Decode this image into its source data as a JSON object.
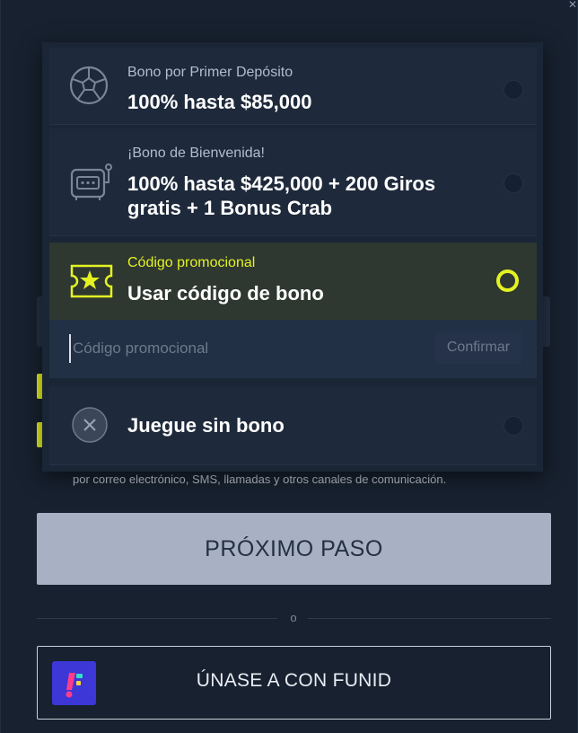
{
  "offers": [
    {
      "icon": "soccer-ball-icon",
      "subtitle": "Bono por Primer Depósito",
      "title": "100% hasta $85,000",
      "selected": false
    },
    {
      "icon": "slot-machine-icon",
      "subtitle": "¡Bono de Bienvenida!",
      "title": "100% hasta $425,000 + 200 Giros gratis + 1 Bonus Crab",
      "selected": false
    },
    {
      "icon": "ticket-star-icon",
      "subtitle": "Código promocional",
      "title": "Usar código de bono",
      "selected": true
    },
    {
      "icon": "close-circle-icon",
      "title": "Juegue sin bono",
      "selected": false
    }
  ],
  "promo": {
    "placeholder": "Código promocional",
    "confirm_label": "Confirmar"
  },
  "consent_text": "por correo electrónico, SMS, llamadas y otros canales de comunicación.",
  "next_button_label": "PRÓXIMO PASO",
  "divider_text": "o",
  "funid_button_label": "ÚNASE A CON FUNID",
  "colors": {
    "accent": "#e4f222",
    "background": "#17212f",
    "option_bg": "#1e2a3b",
    "selected_bg": "#2e3730",
    "next_button_bg": "#a8b1c4",
    "funid_logo_bg": "#3c37d6"
  }
}
